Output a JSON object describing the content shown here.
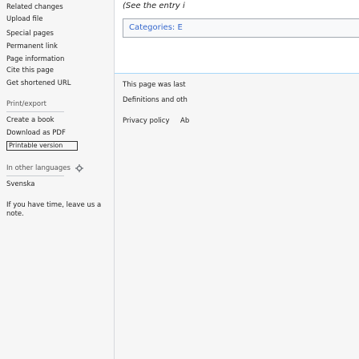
{
  "sidebar": {
    "tools": [
      "Related changes",
      "Upload file",
      "Special pages",
      "Permanent link",
      "Page information",
      "Cite this page",
      "Get shortened URL"
    ],
    "print_heading": "Print/export",
    "print_items": [
      "Create a book",
      "Download as PDF"
    ],
    "printable_version": "Printable version",
    "languages_heading": "In other languages",
    "languages_icon": "gear-icon",
    "languages": [
      "Svenska"
    ],
    "note": "If you have time, leave us a note."
  },
  "content": {
    "see_entry": "(See the entry i",
    "categories_label": "Categories:  E"
  },
  "footer": {
    "last_modified": "This page was last",
    "license": "Definitions and oth",
    "links": [
      "Privacy policy",
      "Ab"
    ]
  }
}
